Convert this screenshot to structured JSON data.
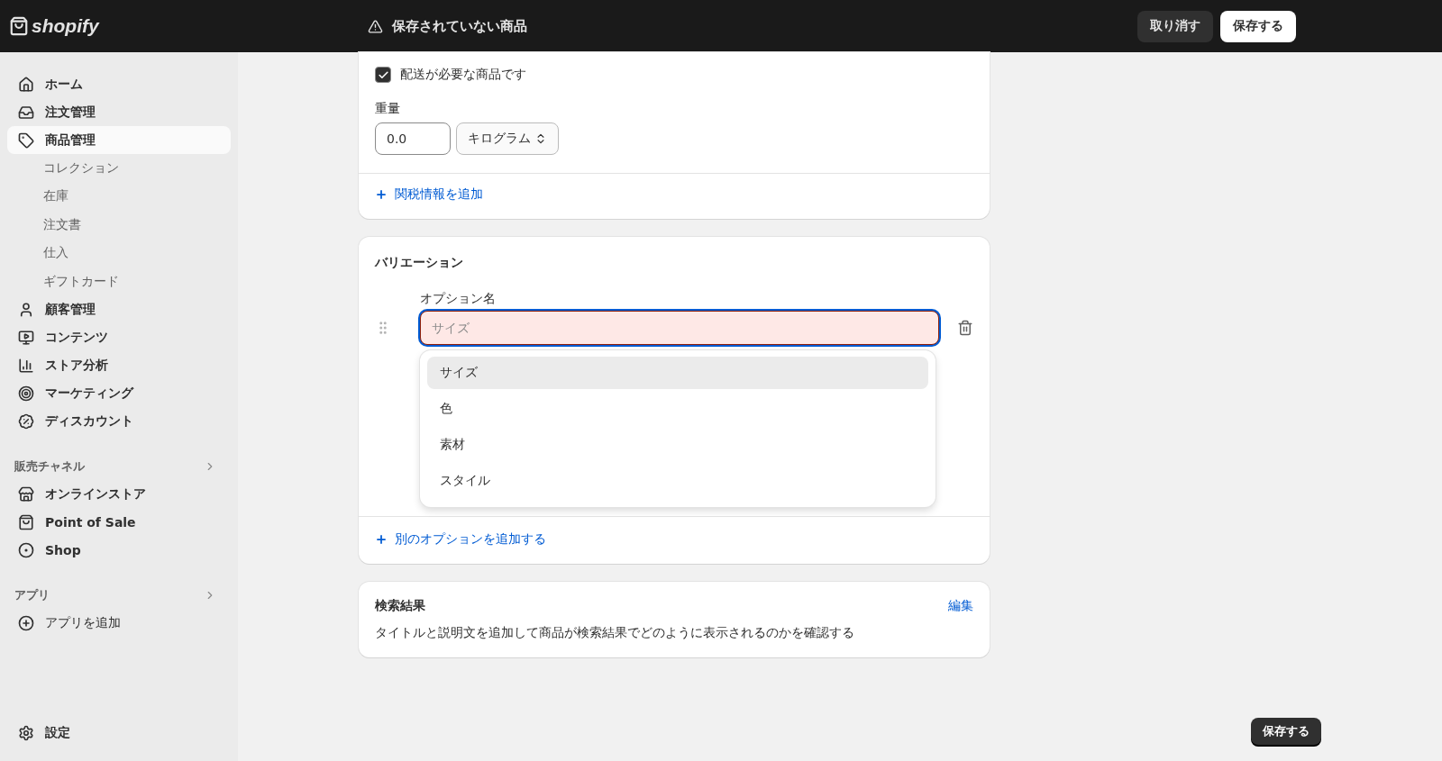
{
  "topbar": {
    "logo": "shopify",
    "title": "保存されていない商品",
    "buttons": [
      {
        "label": "取り消す",
        "kind": "secondary"
      },
      {
        "label": "保存する",
        "kind": "primary"
      }
    ]
  },
  "sidebar": {
    "items": [
      {
        "label": "ホーム",
        "selected": false
      },
      {
        "label": "注文管理",
        "selected": false
      },
      {
        "label": "商品管理",
        "selected": true,
        "children": [
          {
            "label": "コレクション",
            "selected": false
          },
          {
            "label": "在庫",
            "selected": false
          },
          {
            "label": "注文書",
            "selected": false
          },
          {
            "label": "仕入",
            "selected": false
          },
          {
            "label": "ギフトカード",
            "selected": false
          }
        ]
      },
      {
        "label": "顧客管理",
        "selected": false
      },
      {
        "label": "コンテンツ",
        "selected": false
      },
      {
        "label": "ストア分析",
        "selected": false
      },
      {
        "label": "マーケティング",
        "selected": false
      },
      {
        "label": "ディスカウント",
        "selected": false
      }
    ],
    "sections": [
      {
        "title": "販売チャネル",
        "items": [
          {
            "label": "オンラインストア",
            "selected": false
          },
          {
            "label": "Point of Sale",
            "selected": false
          },
          {
            "label": "Shop",
            "selected": false
          }
        ]
      },
      {
        "title": "アプリ",
        "items": [
          {
            "label": "アプリを追加",
            "selected": false
          }
        ]
      }
    ],
    "settings": "設定"
  },
  "shipping": {
    "checkbox": {
      "label": "配送が必要な商品です",
      "checked": true
    },
    "weight": {
      "label": "重量",
      "value": "0.0",
      "unit": "キログラム"
    },
    "link": "関税情報を追加"
  },
  "variants": {
    "title": "バリエーション",
    "option_label": "オプション名",
    "option_field": {
      "placeholder": "サイズ",
      "invalid": true,
      "focused": true
    },
    "options": [
      {
        "label": "サイズ",
        "selected": true
      },
      {
        "label": "色",
        "selected": false
      },
      {
        "label": "素材",
        "selected": false
      },
      {
        "label": "スタイル",
        "selected": false
      }
    ],
    "link": "別のオプションを追加する"
  },
  "seo": {
    "title": "検索結果",
    "edit": "編集",
    "description": "タイトルと説明文を追加して商品が検索結果でどのように表示されるのかを確認する"
  },
  "footer_button": "保存する"
}
